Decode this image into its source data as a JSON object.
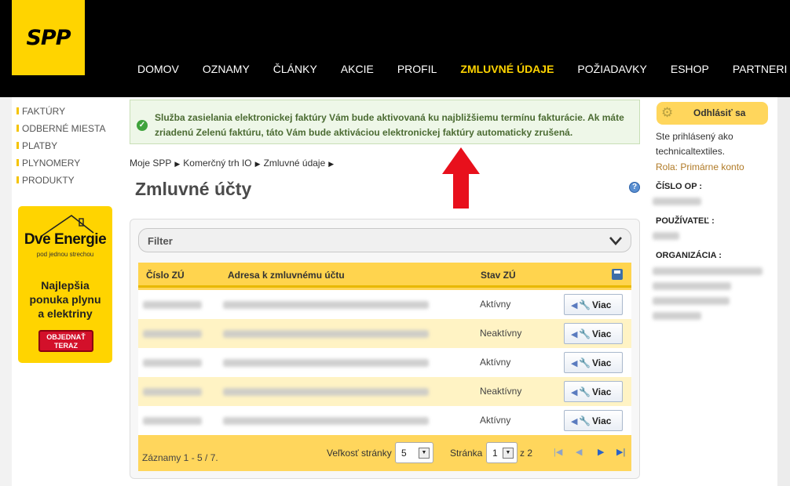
{
  "brand": {
    "logo_text": "SPP"
  },
  "nav": {
    "items": [
      "DOMOV",
      "OZNAMY",
      "ČLÁNKY",
      "AKCIE",
      "PROFIL",
      "ZMLUVNÉ ÚDAJE",
      "POŽIADAVKY",
      "ESHOP",
      "PARTNERI SPP"
    ],
    "active": "ZMLUVNÉ ÚDAJE"
  },
  "sidebar": {
    "items": [
      "FAKTÚRY",
      "ODBERNÉ MIESTA",
      "PLATBY",
      "PLYNOMERY",
      "PRODUKTY"
    ]
  },
  "promo": {
    "brand": "Dve Energie",
    "tagline": "pod jednou strechou",
    "line1": "Najlepšia",
    "line2": "ponuka plynu",
    "line3": "a elektriny",
    "button_line1": "OBJEDNAŤ",
    "button_line2": "TERAZ"
  },
  "notice": {
    "line1": "Služba zasielania elektronickej faktúry Vám bude aktivovaná ku najbližšiemu termínu fakturácie. Ak máte",
    "line2": "zriadenú Zelenú faktúru, táto Vám bude aktiváciou elektronickej faktúry automaticky zrušená."
  },
  "breadcrumb": [
    "Moje SPP",
    "Komerčný trh IO",
    "Zmluvné údaje"
  ],
  "page": {
    "title": "Zmluvné účty"
  },
  "filter": {
    "label": "Filter"
  },
  "table": {
    "headers": [
      "Číslo ZÚ",
      "Adresa k zmluvnému účtu",
      "Stav ZÚ"
    ],
    "rows": [
      {
        "status": "Aktívny",
        "action": "Viac"
      },
      {
        "status": "Neaktívny",
        "action": "Viac"
      },
      {
        "status": "Aktívny",
        "action": "Viac"
      },
      {
        "status": "Neaktívny",
        "action": "Viac"
      },
      {
        "status": "Aktívny",
        "action": "Viac"
      }
    ]
  },
  "pagination": {
    "records": "Záznamy 1 - 5 / 7.",
    "page_size_label": "Veľkosť stránky",
    "page_size": "5",
    "page_label": "Stránka",
    "page": "1",
    "of": "z 2"
  },
  "account": {
    "logout_label": "Odhlásiť sa",
    "logged_in_line1": "Ste prihlásený ako",
    "username": "technicaltextiles.",
    "role": "Rola: Primárne konto",
    "op_label": "ČÍSLO OP :",
    "user_label": "POUŽÍVATEĽ :",
    "org_label": "ORGANIZÁCIA :"
  },
  "icons": {
    "notice": "check-circle-icon",
    "help": "help-icon",
    "filter_toggle": "chevron-down-icon",
    "export": "save-icon",
    "logout": "gear-icon",
    "annotation": "red-arrow-up"
  },
  "colors": {
    "brand_yellow": "#ffd400",
    "nav_active": "#ffd400",
    "header_bg": "#000000",
    "notice_green": "#4b6b32",
    "role_text": "#b07a26",
    "arrow_red": "#e8101c"
  }
}
